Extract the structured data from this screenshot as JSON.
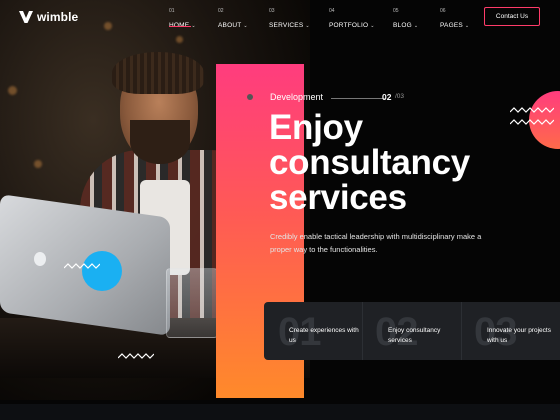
{
  "brand": {
    "name": "wimble"
  },
  "nav": {
    "items": [
      {
        "num": "01",
        "label": "HOME",
        "active": true
      },
      {
        "num": "02",
        "label": "ABOUT"
      },
      {
        "num": "03",
        "label": "SERVICES"
      },
      {
        "num": "04",
        "label": "PORTFOLIO"
      },
      {
        "num": "05",
        "label": "BLOG"
      },
      {
        "num": "06",
        "label": "PAGES"
      }
    ],
    "contact_label": "Contact Us"
  },
  "slide": {
    "category": "Development",
    "current": "02",
    "total": "/03",
    "headline": [
      "Enjoy",
      "consultancy",
      "services"
    ],
    "description": "Credibly enable tactical leadership with multidisciplinary make a proper way to the functionalities."
  },
  "features": [
    {
      "num": "01",
      "text": "Create experiences with us"
    },
    {
      "num": "02",
      "text": "Enjoy consultancy services"
    },
    {
      "num": "03",
      "text": "Innovate your projects with us"
    }
  ],
  "colors": {
    "accent_pink": "#ff3c7e",
    "accent_orange": "#ff8a2a",
    "accent_blue": "#1ab0f2",
    "background": "#050505"
  },
  "icons": {
    "logo": "wimble-logo-icon",
    "dropdown": "chevron-down-icon"
  }
}
